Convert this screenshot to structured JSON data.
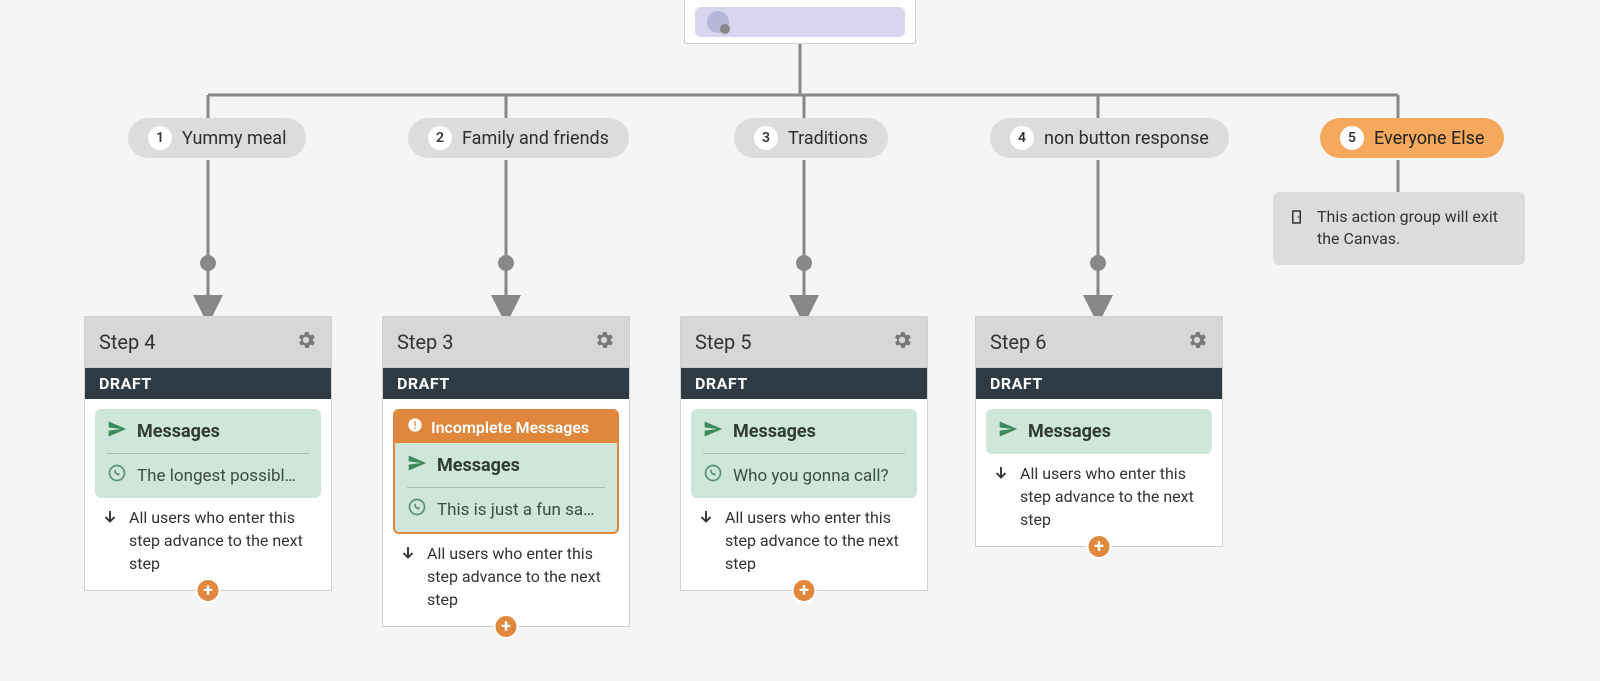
{
  "branches": [
    {
      "num": "1",
      "label": "Yummy meal"
    },
    {
      "num": "2",
      "label": "Family and friends"
    },
    {
      "num": "3",
      "label": "Traditions"
    },
    {
      "num": "4",
      "label": "non button response"
    },
    {
      "num": "5",
      "label": "Everyone Else"
    }
  ],
  "steps": [
    {
      "title": "Step 4",
      "draft": "DRAFT",
      "messages_label": "Messages",
      "message_text": "The longest possibl…",
      "advance": "All users who enter this step advance to the next step",
      "incomplete": false,
      "has_message_text": true
    },
    {
      "title": "Step 3",
      "draft": "DRAFT",
      "messages_label": "Messages",
      "incomplete_label": "Incomplete Messages",
      "message_text": "This is just a fun sa…",
      "advance": "All users who enter this step advance to the next step",
      "incomplete": true,
      "has_message_text": true
    },
    {
      "title": "Step 5",
      "draft": "DRAFT",
      "messages_label": "Messages",
      "message_text": "Who you gonna call?",
      "advance": "All users who enter this step advance to the next step",
      "incomplete": false,
      "has_message_text": true
    },
    {
      "title": "Step 6",
      "draft": "DRAFT",
      "messages_label": "Messages",
      "advance": "All users who enter this step advance to the next step",
      "incomplete": false,
      "has_message_text": false
    }
  ],
  "info_card": "This action group will exit the Canvas."
}
